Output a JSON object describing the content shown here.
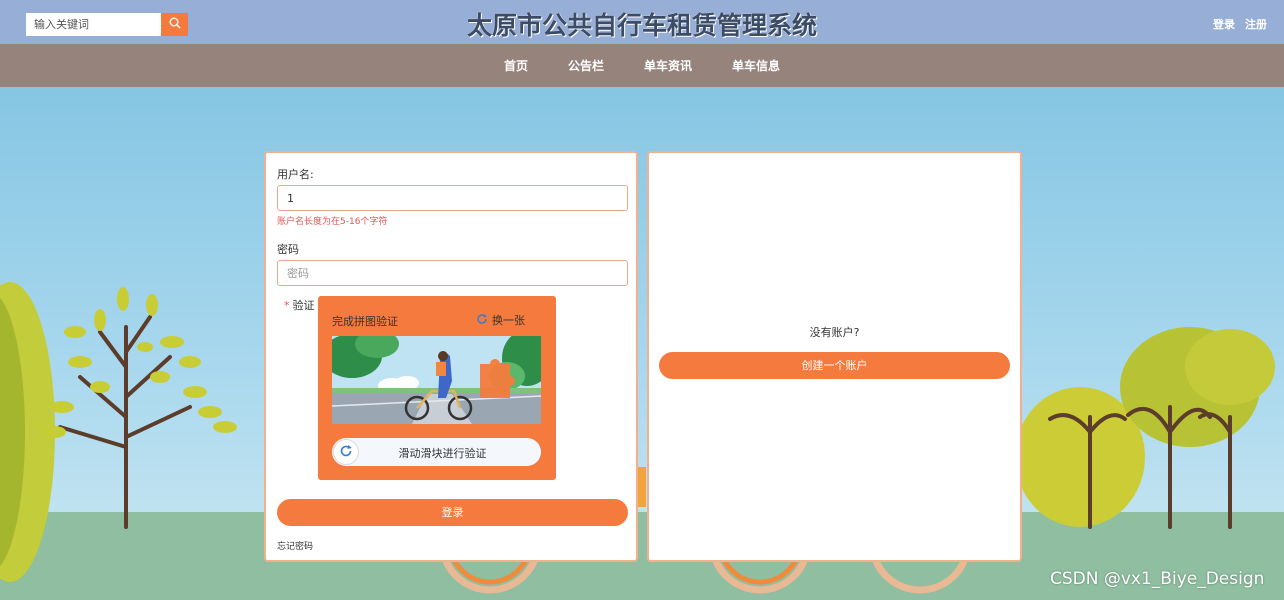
{
  "header": {
    "site_title": "太原市公共自行车租赁管理系统",
    "search_placeholder": "输入关键词",
    "search_icon": "search-icon",
    "login_link": "登录",
    "register_link": "注册"
  },
  "nav": {
    "items": [
      {
        "label": "首页"
      },
      {
        "label": "公告栏"
      },
      {
        "label": "单车资讯"
      },
      {
        "label": "单车信息"
      }
    ]
  },
  "login_form": {
    "username_label": "用户名:",
    "username_value": "1",
    "username_error": "账户名长度为在5-16个字符",
    "password_label": "密码",
    "password_placeholder": "密码",
    "captcha_required_mark": "*",
    "captcha_label": "验证",
    "captcha_title": "完成拼图验证",
    "captcha_refresh_label": "换一张",
    "captcha_refresh_icon": "refresh-icon",
    "captcha_slider_text": "滑动滑块进行验证",
    "captcha_slider_icon": "refresh-icon",
    "submit_label": "登录",
    "forgot_label": "忘记密码"
  },
  "register_panel": {
    "prompt": "没有账户?",
    "create_label": "创建一个账户"
  },
  "watermark": "CSDN @vx1_Biye_Design",
  "colors": {
    "accent": "#f47a3d",
    "topbar": "#97aed6",
    "navbar": "#96837b",
    "card_border": "#f1b08e",
    "error": "#e25555"
  }
}
